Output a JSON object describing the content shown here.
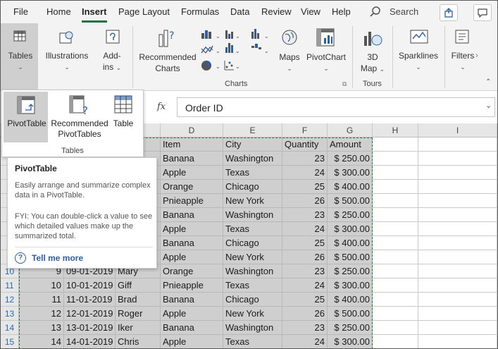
{
  "menu": {
    "items": [
      "File",
      "Home",
      "Insert",
      "Page Layout",
      "Formulas",
      "Data",
      "Review",
      "View",
      "Help"
    ],
    "active": "Insert",
    "search_label": "Search"
  },
  "ribbon": {
    "tables": "Tables",
    "illustrations": "Illustrations",
    "addins": [
      "Add-",
      "ins"
    ],
    "recommended_charts": [
      "Recommended",
      "Charts"
    ],
    "maps": "Maps",
    "pivotchart": "PivotChart",
    "map3d": [
      "3D",
      "Map"
    ],
    "sparklines": "Sparklines",
    "filters": "Filters",
    "group_charts": "Charts",
    "group_tours": "Tours"
  },
  "formula_bar": {
    "fx": "fx",
    "value": "Order ID"
  },
  "panel": {
    "pivottable": "PivotTable",
    "recommended_pivottables": [
      "Recommended",
      "PivotTables"
    ],
    "table": "Table",
    "group": "Tables"
  },
  "tooltip": {
    "title": "PivotTable",
    "body1": "Easily arrange and summarize complex data in a PivotTable.",
    "body2": "FYI: You can double-click a value to see which detailed values make up the summarized total.",
    "link": "Tell me more"
  },
  "grid": {
    "columns": [
      "D",
      "E",
      "F",
      "G",
      "H",
      "I"
    ],
    "rows_visible_headers": [
      "10",
      "11",
      "12",
      "13",
      "14",
      "15"
    ],
    "header_row": [
      "Item",
      "City",
      "Quantity",
      "Amount"
    ],
    "top_rows": [
      [
        "Banana",
        "Washington",
        "23",
        "$ 250.00"
      ],
      [
        "Apple",
        "Texas",
        "24",
        "$ 300.00"
      ],
      [
        "Orange",
        "Chicago",
        "25",
        "$ 400.00"
      ],
      [
        "Pnieapple",
        "New York",
        "26",
        "$ 500.00"
      ],
      [
        "Banana",
        "Washington",
        "23",
        "$ 250.00"
      ],
      [
        "Apple",
        "Texas",
        "24",
        "$ 300.00"
      ],
      [
        "Banana",
        "Chicago",
        "25",
        "$ 400.00"
      ],
      [
        "Apple",
        "New York",
        "26",
        "$ 500.00"
      ]
    ],
    "full_rows": [
      [
        "9",
        "09-01-2019",
        "Mary",
        "Orange",
        "Washington",
        "23",
        "$ 250.00"
      ],
      [
        "10",
        "10-01-2019",
        "Giff",
        "Pnieapple",
        "Texas",
        "24",
        "$ 300.00"
      ],
      [
        "11",
        "11-01-2019",
        "Brad",
        "Banana",
        "Chicago",
        "25",
        "$ 400.00"
      ],
      [
        "12",
        "12-01-2019",
        "Roger",
        "Apple",
        "New York",
        "26",
        "$ 500.00"
      ],
      [
        "13",
        "13-01-2019",
        "Iker",
        "Banana",
        "Washington",
        "23",
        "$ 250.00"
      ],
      [
        "14",
        "14-01-2019",
        "Chris",
        "Apple",
        "Texas",
        "24",
        "$ 300.00"
      ]
    ]
  },
  "colors": {
    "accent": "#217346",
    "link": "#2a5fa8",
    "selection": "#cfcfcf"
  }
}
